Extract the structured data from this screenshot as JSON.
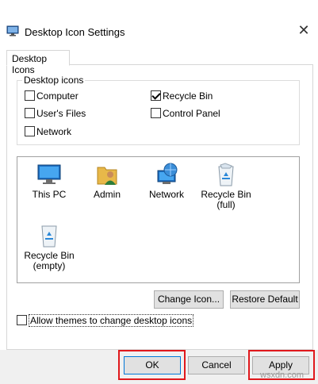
{
  "window": {
    "title": "Desktop Icon Settings",
    "close_symbol": "✕"
  },
  "tabs": [
    {
      "label": "Desktop Icons"
    }
  ],
  "desktop_icons_group": {
    "legend": "Desktop icons",
    "checkboxes": [
      {
        "label": "Computer",
        "checked": false
      },
      {
        "label": "Recycle Bin",
        "checked": true
      },
      {
        "label": "User's Files",
        "checked": false
      },
      {
        "label": "Control Panel",
        "checked": false
      },
      {
        "label": "Network",
        "checked": false
      }
    ]
  },
  "icon_list": [
    {
      "label": "This PC",
      "icon": "monitor-icon"
    },
    {
      "label": "Admin",
      "icon": "user-folder-icon"
    },
    {
      "label": "Network",
      "icon": "network-globe-icon"
    },
    {
      "label": "Recycle Bin\n(full)",
      "icon": "recycle-bin-full-icon"
    },
    {
      "label": "Recycle Bin\n(empty)",
      "icon": "recycle-bin-empty-icon"
    }
  ],
  "buttons": {
    "change_icon": "Change Icon...",
    "restore_default": "Restore Default",
    "ok": "OK",
    "cancel": "Cancel",
    "apply": "Apply"
  },
  "allow_themes": {
    "label": "Allow themes to change desktop icons",
    "checked": false
  },
  "watermark": "wsxdn.com",
  "colors": {
    "highlight_box": "#e0181c",
    "button_bg": "#e1e1e1",
    "default_border": "#0078d7"
  }
}
